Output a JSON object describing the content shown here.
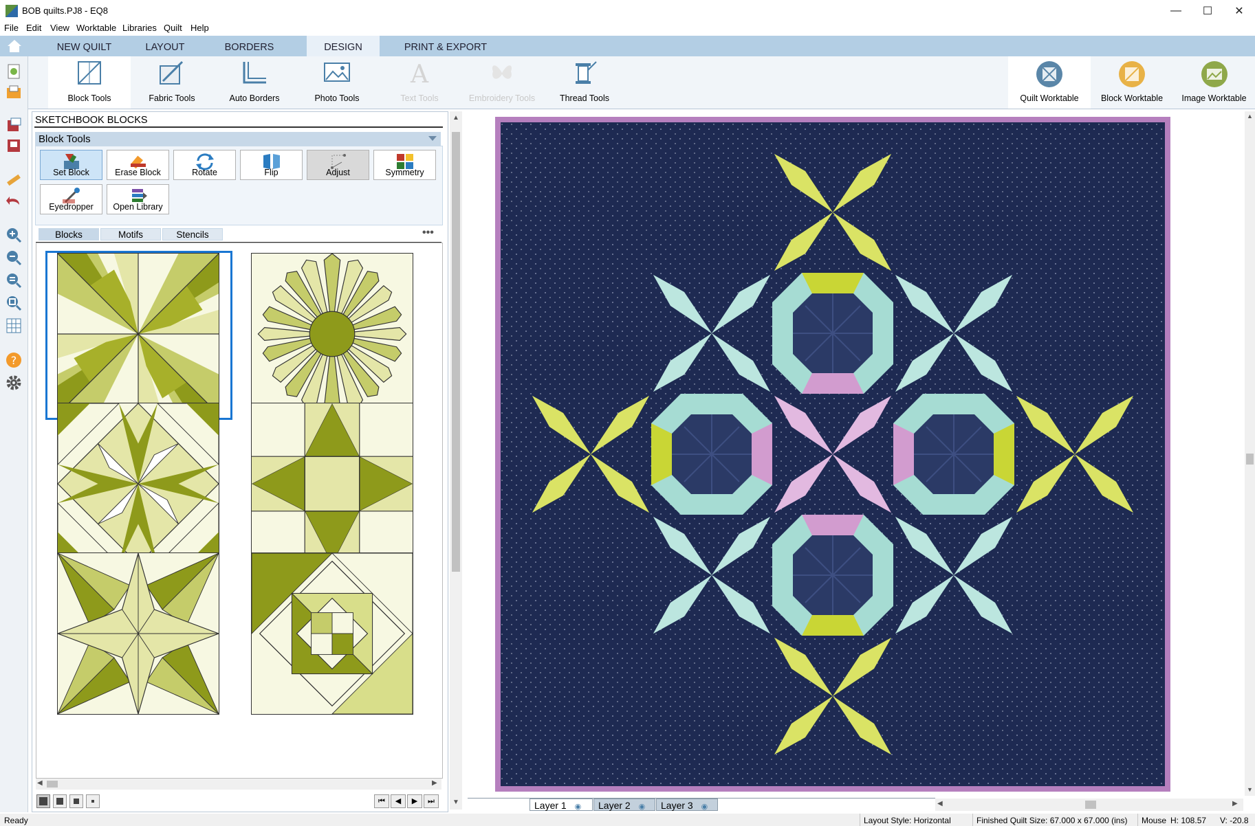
{
  "window": {
    "title": "BOB quilts.PJ8 - EQ8",
    "minimize": "—",
    "maximize": "☐",
    "close": "✕"
  },
  "menu": [
    "File",
    "Edit",
    "View",
    "Worktable",
    "Libraries",
    "Quilt",
    "Help"
  ],
  "tabs": [
    {
      "label": "NEW QUILT"
    },
    {
      "label": "LAYOUT"
    },
    {
      "label": "BORDERS"
    },
    {
      "label": "DESIGN"
    },
    {
      "label": "PRINT & EXPORT"
    }
  ],
  "ribbon": {
    "block_tools": "Block Tools",
    "fabric_tools": "Fabric Tools",
    "auto_borders": "Auto Borders",
    "photo_tools": "Photo Tools",
    "text_tools": "Text Tools",
    "embroidery_tools": "Embroidery Tools",
    "thread_tools": "Thread Tools",
    "quilt_worktable": "Quilt Worktable",
    "block_worktable": "Block Worktable",
    "image_worktable": "Image Worktable"
  },
  "panel": {
    "title": "SKETCHBOOK BLOCKS",
    "section": "Block Tools",
    "tools": {
      "set_block": "Set Block",
      "erase_block": "Erase Block",
      "rotate": "Rotate",
      "flip": "Flip",
      "adjust": "Adjust",
      "symmetry": "Symmetry",
      "eyedropper": "Eyedropper",
      "open_library": "Open Library"
    },
    "subtabs": {
      "blocks": "Blocks",
      "motifs": "Motifs",
      "stencils": "Stencils"
    },
    "more": "•••"
  },
  "layers": {
    "layer1": "Layer 1",
    "layer2": "Layer 2",
    "layer3": "Layer 3"
  },
  "status": {
    "ready": "Ready",
    "layout_style": "Layout Style: Horizontal",
    "finished_size": "Finished Quilt Size: 67.000 x 67.000 (ins)",
    "mouse_label": "Mouse",
    "mouse_h": "H:  108.57",
    "mouse_v": "V:  -20.8"
  },
  "colors": {
    "quilt_background": "#1e2a52",
    "quilt_border": "#b57fbe",
    "lime": "#c9d635",
    "aqua": "#a6dcd3",
    "pink": "#d29ccf",
    "olive": "#8e9a1b",
    "cream": "#f7f8e2",
    "tab_bar": "#b3cee4"
  }
}
